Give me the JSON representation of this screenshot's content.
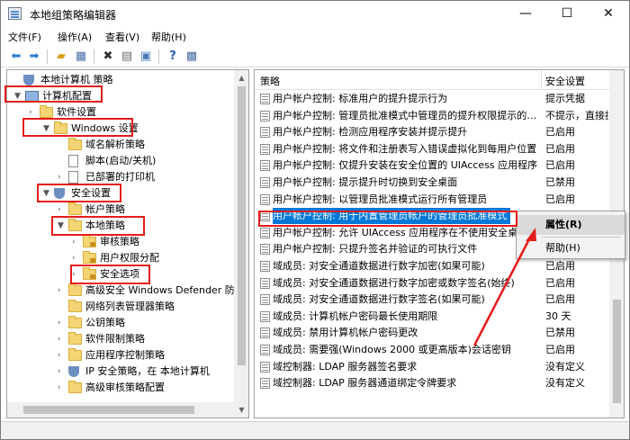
{
  "window": {
    "title": "本地组策略编辑器"
  },
  "window_buttons": {
    "min": "—",
    "max": "☐",
    "close": "✕"
  },
  "menu": [
    "文件(F)",
    "操作(A)",
    "查看(V)",
    "帮助(H)"
  ],
  "toolbar": [
    "back-icon",
    "forward-icon",
    "up-folder-icon",
    "show-hide-tree-icon",
    "delete-icon",
    "properties-icon",
    "export-icon",
    "help-icon",
    "filter-icon"
  ],
  "highlight_color": "#e51b1b",
  "selection_color": "#0078d7",
  "tree": [
    {
      "label": "本地计算机 策略",
      "arrow": "",
      "icon": "shield"
    },
    {
      "label": "计算机配置",
      "arrow": "▼",
      "icon": "pc"
    },
    {
      "label": "软件设置",
      "arrow": "›",
      "icon": "folder"
    },
    {
      "label": "Windows 设置",
      "arrow": "▼",
      "icon": "folder"
    },
    {
      "label": "域名解析策略",
      "arrow": "",
      "icon": "folder"
    },
    {
      "label": "脚本(启动/关机)",
      "arrow": "",
      "icon": "doc"
    },
    {
      "label": "已部署的打印机",
      "arrow": "›",
      "icon": "doc"
    },
    {
      "label": "安全设置",
      "arrow": "▼",
      "icon": "shield"
    },
    {
      "label": "帐户策略",
      "arrow": "›",
      "icon": "folder"
    },
    {
      "label": "本地策略",
      "arrow": "▼",
      "icon": "folder"
    },
    {
      "label": "审核策略",
      "arrow": "›",
      "icon": "folder-lock"
    },
    {
      "label": "用户权限分配",
      "arrow": "›",
      "icon": "folder-lock"
    },
    {
      "label": "安全选项",
      "arrow": "›",
      "icon": "folder-lock"
    },
    {
      "label": "高级安全 Windows Defender 防",
      "arrow": "›",
      "icon": "folder"
    },
    {
      "label": "网络列表管理器策略",
      "arrow": "",
      "icon": "folder"
    },
    {
      "label": "公钥策略",
      "arrow": "›",
      "icon": "folder"
    },
    {
      "label": "软件限制策略",
      "arrow": "›",
      "icon": "folder"
    },
    {
      "label": "应用程序控制策略",
      "arrow": "›",
      "icon": "folder"
    },
    {
      "label": "IP 安全策略，在 本地计算机",
      "arrow": "›",
      "icon": "shield"
    },
    {
      "label": "高级审核策略配置",
      "arrow": "›",
      "icon": "folder"
    }
  ],
  "columns": {
    "policy": "策略",
    "setting": "安全设置"
  },
  "policies": [
    {
      "name": "用户帐户控制: 标准用户的提升提示行为",
      "setting": "提示凭据"
    },
    {
      "name": "用户帐户控制: 管理员批准模式中管理员的提升权限提示的…",
      "setting": "不提示，直接提"
    },
    {
      "name": "用户帐户控制: 检测应用程序安装并提示提升",
      "setting": "已启用"
    },
    {
      "name": "用户帐户控制: 将文件和注册表写入错误虚拟化到每用户位置",
      "setting": "已启用"
    },
    {
      "name": "用户帐户控制: 仅提升安装在安全位置的 UIAccess 应用程序",
      "setting": "已启用"
    },
    {
      "name": "用户帐户控制: 提示提升时切换到安全桌面",
      "setting": "已禁用"
    },
    {
      "name": "用户帐户控制: 以管理员批准模式运行所有管理员",
      "setting": "已启用"
    },
    {
      "name": "用户帐户控制: 用于内置管理员帐户的管理员批准模式",
      "setting": ""
    },
    {
      "name": "用户帐户控制: 允许 UIAccess 应用程序在不使用安全桌面",
      "setting": ""
    },
    {
      "name": "用户帐户控制: 只提升签名并验证的可执行文件",
      "setting": ""
    },
    {
      "name": "域成员: 对安全通道数据进行数字加密(如果可能)",
      "setting": "已启用"
    },
    {
      "name": "域成员: 对安全通道数据进行数字加密或数字签名(始终)",
      "setting": "已启用"
    },
    {
      "name": "域成员: 对安全通道数据进行数字签名(如果可能)",
      "setting": "已启用"
    },
    {
      "name": "域成员: 计算机帐户密码最长使用期限",
      "setting": "30 天"
    },
    {
      "name": "域成员: 禁用计算机帐户密码更改",
      "setting": "已禁用"
    },
    {
      "name": "域成员: 需要强(Windows 2000 或更高版本)会话密钥",
      "setting": "已启用"
    },
    {
      "name": "域控制器: LDAP 服务器签名要求",
      "setting": "没有定义"
    },
    {
      "name": "域控制器: LDAP 服务器通道绑定令牌要求",
      "setting": "没有定义"
    }
  ],
  "context_menu": {
    "properties": "属性(R)",
    "help": "帮助(H)"
  }
}
